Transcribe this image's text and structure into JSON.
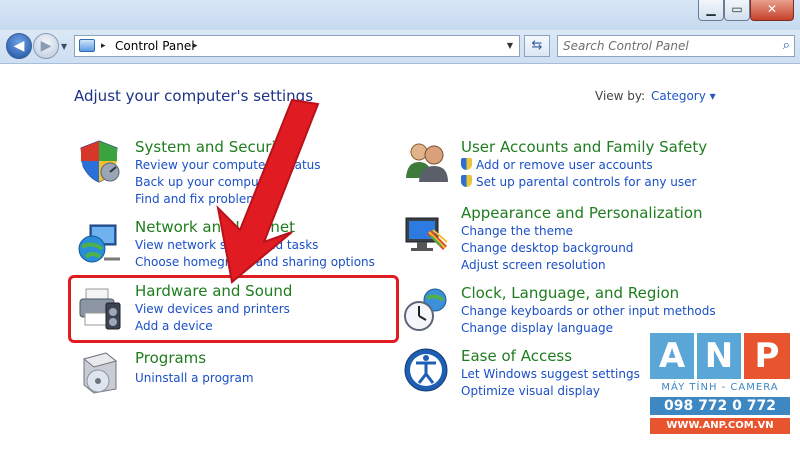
{
  "window": {
    "min_glyph": "▁",
    "max_glyph": "▭",
    "close_glyph": "✕"
  },
  "address": {
    "crumb": "Control Panel",
    "separator": "▸"
  },
  "search": {
    "placeholder": "Search Control Panel"
  },
  "content": {
    "heading": "Adjust your computer's settings",
    "view_by_label": "View by:",
    "view_by_value": "Category ▾"
  },
  "categories": {
    "system": {
      "title": "System and Security",
      "links": [
        "Review your computer's status",
        "Back up your computer",
        "Find and fix problems"
      ]
    },
    "network": {
      "title": "Network and Internet",
      "links": [
        "View network status and tasks",
        "Choose homegroup and sharing options"
      ]
    },
    "hardware": {
      "title": "Hardware and Sound",
      "links": [
        "View devices and printers",
        "Add a device"
      ]
    },
    "programs": {
      "title": "Programs",
      "links": [
        "Uninstall a program"
      ]
    },
    "users": {
      "title": "User Accounts and Family Safety",
      "links": [
        "Add or remove user accounts",
        "Set up parental controls for any user"
      ]
    },
    "appearance": {
      "title": "Appearance and Personalization",
      "links": [
        "Change the theme",
        "Change desktop background",
        "Adjust screen resolution"
      ]
    },
    "clock": {
      "title": "Clock, Language, and Region",
      "links": [
        "Change keyboards or other input methods",
        "Change display language"
      ]
    },
    "ease": {
      "title": "Ease of Access",
      "links": [
        "Let Windows suggest settings",
        "Optimize visual display"
      ]
    }
  },
  "watermark": {
    "letters": [
      "A",
      "N",
      "P"
    ],
    "subtitle": "MÁY TÍNH - CAMERA",
    "phone": "098 772 0 772",
    "website": "WWW.ANP.COM.VN"
  },
  "colors": {
    "category_title": "#1e7d1e",
    "link": "#1a4fc7",
    "highlight": "#e01b22"
  }
}
